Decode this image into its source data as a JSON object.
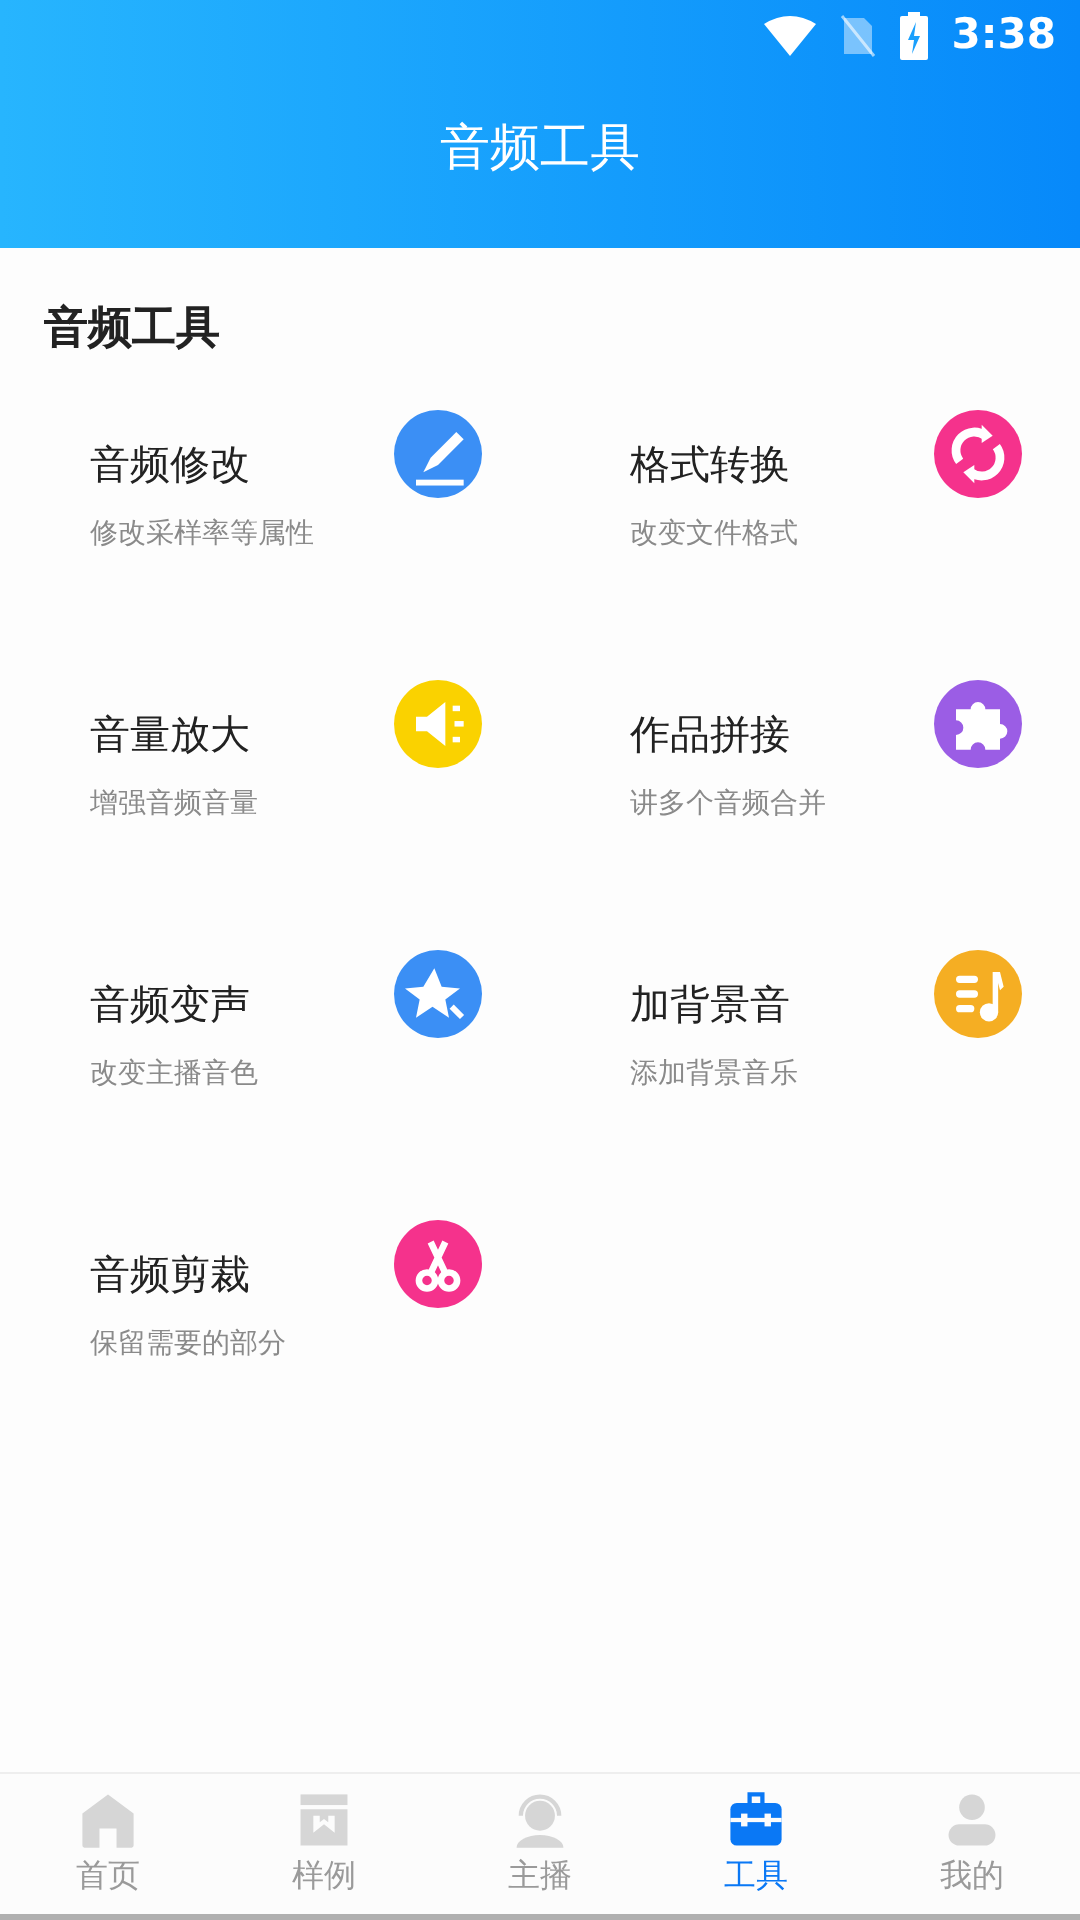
{
  "status_bar": {
    "time": "3:38"
  },
  "header": {
    "title": "音频工具"
  },
  "section": {
    "title": "音频工具"
  },
  "tools": [
    {
      "title": "音频修改",
      "subtitle": "修改采样率等属性",
      "kind": "edit",
      "color": "#3b8ff5"
    },
    {
      "title": "格式转换",
      "subtitle": "改变文件格式",
      "kind": "convert",
      "color": "#f5328c"
    },
    {
      "title": "音量放大",
      "subtitle": "增强音频音量",
      "kind": "volume",
      "color": "#fad200"
    },
    {
      "title": "作品拼接",
      "subtitle": "讲多个音频合并",
      "kind": "puzzle",
      "color": "#9b5de5"
    },
    {
      "title": "音频变声",
      "subtitle": "改变主播音色",
      "kind": "star",
      "color": "#3b8ff5"
    },
    {
      "title": "加背景音",
      "subtitle": "添加背景音乐",
      "kind": "music",
      "color": "#f5ae23"
    },
    {
      "title": "音频剪裁",
      "subtitle": "保留需要的部分",
      "kind": "scissors",
      "color": "#f5328c"
    }
  ],
  "tabs": [
    {
      "label": "首页",
      "kind": "home",
      "selected": false
    },
    {
      "label": "样例",
      "kind": "shop",
      "selected": false
    },
    {
      "label": "主播",
      "kind": "headset",
      "selected": false
    },
    {
      "label": "工具",
      "kind": "toolbox",
      "selected": true
    },
    {
      "label": "我的",
      "kind": "person",
      "selected": false
    }
  ]
}
